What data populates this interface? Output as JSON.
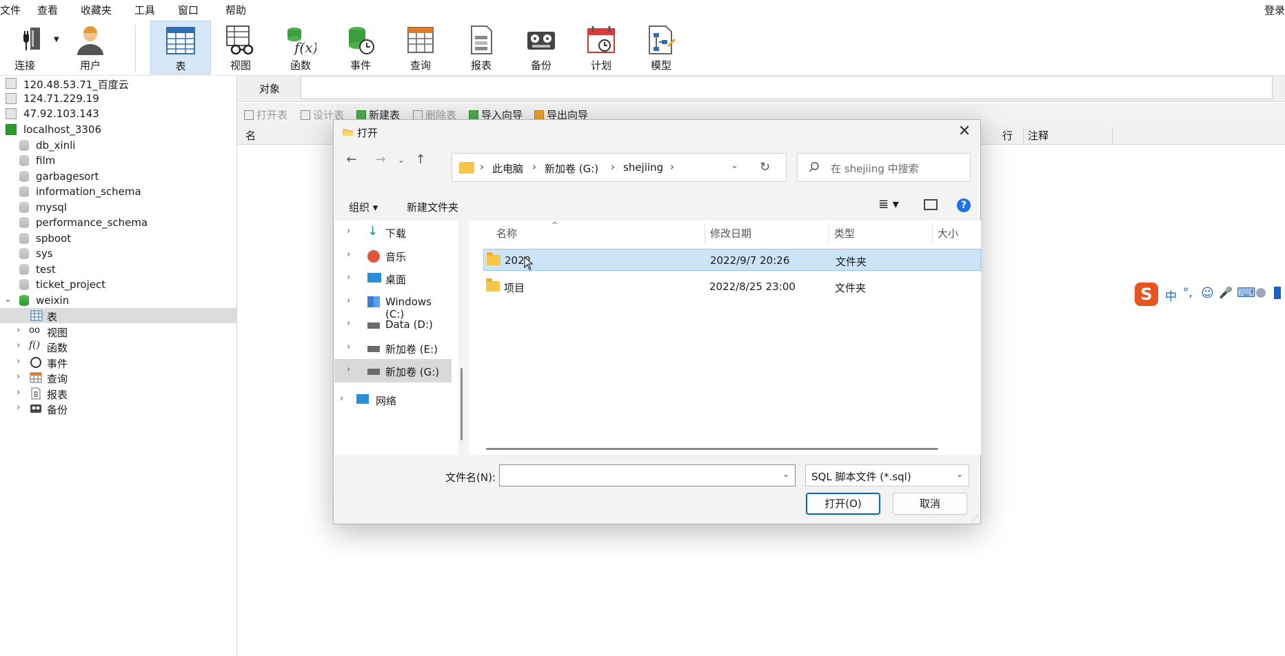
{
  "menubar": {
    "items": [
      "文件",
      "查看",
      "收藏夹",
      "工具",
      "窗口",
      "帮助"
    ],
    "login": "登录"
  },
  "toolbar": {
    "connect": "连接",
    "user": "用户",
    "table": "表",
    "view": "视图",
    "function": "函数",
    "event": "事件",
    "query": "查询",
    "report": "报表",
    "backup": "备份",
    "schedule": "计划",
    "model": "模型"
  },
  "tree": {
    "connections": [
      {
        "label": "120.48.53.71_百度云"
      },
      {
        "label": "124.71.229.19"
      },
      {
        "label": "47.92.103.143"
      },
      {
        "label": "localhost_3306"
      }
    ],
    "databases": [
      "db_xinli",
      "film",
      "garbagesort",
      "information_schema",
      "mysql",
      "performance_schema",
      "spboot",
      "sys",
      "test",
      "ticket_project",
      "weixin"
    ],
    "weixin_children": [
      "表",
      "视图",
      "函数",
      "事件",
      "查询",
      "报表",
      "备份"
    ]
  },
  "objects": {
    "tab_label": "对象",
    "actions": [
      "打开表",
      "设计表",
      "新建表",
      "删除表",
      "导入向导",
      "导出向导"
    ],
    "col_name": "名",
    "col_rows": "行",
    "col_comment": "注释"
  },
  "ime": {
    "items": [
      "中",
      "°,",
      "☺",
      "🎤",
      "⌨"
    ]
  },
  "dialog": {
    "title": "打开",
    "close": "✕",
    "address": [
      "此电脑",
      "新加卷 (G:)",
      "shejiing"
    ],
    "search_placeholder": "在 shejiing 中搜索",
    "organize": "组织 ▾",
    "new_folder": "新建文件夹",
    "nav": [
      {
        "label": "下载"
      },
      {
        "label": "音乐"
      },
      {
        "label": "桌面"
      },
      {
        "label": "Windows (C:)"
      },
      {
        "label": "Data (D:)"
      },
      {
        "label": "新加卷 (E:)"
      },
      {
        "label": "新加卷 (G:)"
      },
      {
        "label": "网络"
      }
    ],
    "columns": {
      "name": "名称",
      "modified": "修改日期",
      "type": "类型",
      "size": "大小"
    },
    "files": [
      {
        "name": "2022",
        "modified": "2022/9/7 20:26",
        "type": "文件夹"
      },
      {
        "name": "项目",
        "modified": "2022/8/25 23:00",
        "type": "文件夹"
      }
    ],
    "filename_label": "文件名(N):",
    "filename_value": "",
    "filetype": "SQL 脚本文件 (*.sql)",
    "open_button": "打开(O)",
    "cancel_button": "取消"
  }
}
